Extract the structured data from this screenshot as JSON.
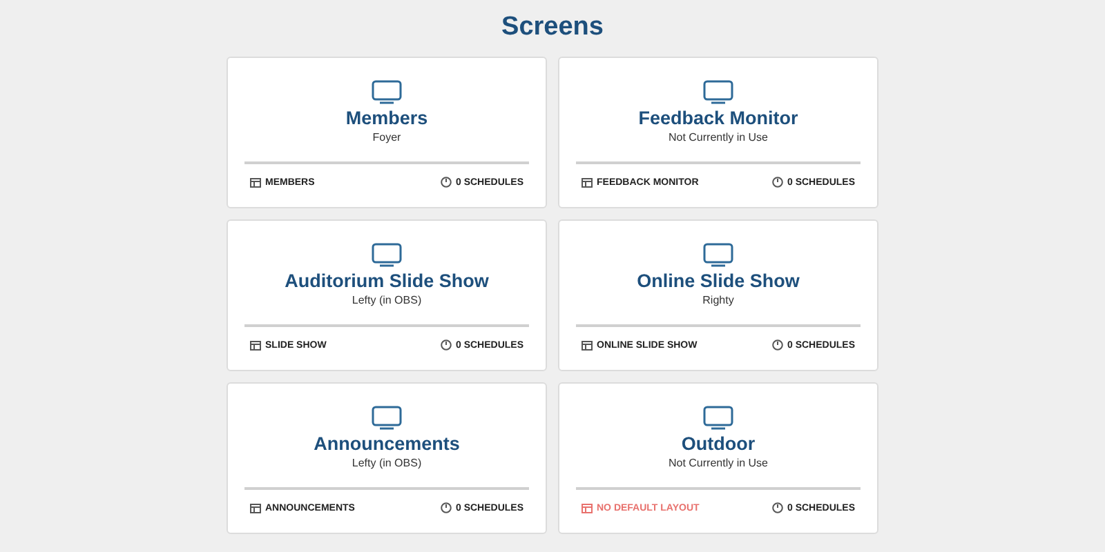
{
  "title": "Screens",
  "screens": [
    {
      "name": "Members",
      "location": "Foyer",
      "layout": "MEMBERS",
      "layout_missing": false,
      "schedules": "0 SCHEDULES"
    },
    {
      "name": "Feedback Monitor",
      "location": "Not Currently in Use",
      "layout": "FEEDBACK MONITOR",
      "layout_missing": false,
      "schedules": "0 SCHEDULES"
    },
    {
      "name": "Auditorium Slide Show",
      "location": "Lefty (in OBS)",
      "layout": "SLIDE SHOW",
      "layout_missing": false,
      "schedules": "0 SCHEDULES"
    },
    {
      "name": "Online Slide Show",
      "location": "Righty",
      "layout": "ONLINE SLIDE SHOW",
      "layout_missing": false,
      "schedules": "0 SCHEDULES"
    },
    {
      "name": "Announcements",
      "location": "Lefty (in OBS)",
      "layout": "ANNOUNCEMENTS",
      "layout_missing": false,
      "schedules": "0 SCHEDULES"
    },
    {
      "name": "Outdoor",
      "location": "Not Currently in Use",
      "layout": "NO DEFAULT LAYOUT",
      "layout_missing": true,
      "schedules": "0 SCHEDULES"
    }
  ]
}
